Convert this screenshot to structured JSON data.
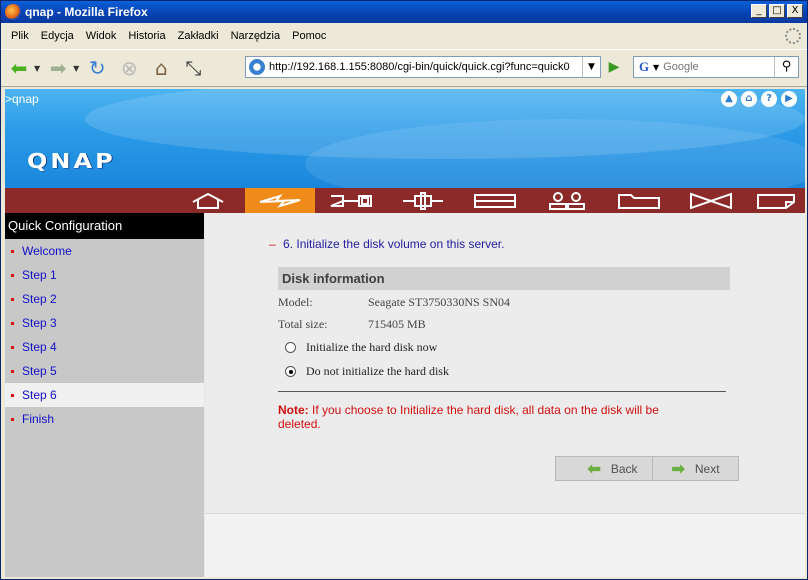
{
  "window": {
    "title": "qnap - Mozilla Firefox",
    "controls": [
      "_",
      "□",
      "X"
    ]
  },
  "menu": [
    "Plik",
    "Edycja",
    "Widok",
    "Historia",
    "Zakładki",
    "Narzędzia",
    "Pomoc"
  ],
  "toolbar": {
    "url": "http://192.168.1.155:8080/cgi-bin/quick/quick.cgi?func=quick0",
    "search_engine_icon": "G",
    "search_placeholder": "Google"
  },
  "banner": {
    "breadcrumb": ">qnap",
    "logo": "QNAP",
    "right_icons": [
      "up-icon",
      "home-icon",
      "help-icon",
      "next-icon"
    ]
  },
  "main_nav": [
    "home-icon",
    "quick-config-icon",
    "system-icon",
    "network-icon",
    "disk-icon",
    "users-icon",
    "shares-icon",
    "system-tools-icon",
    "logs-icon"
  ],
  "sidebar": {
    "heading": "Quick Configuration",
    "items": [
      "Welcome",
      "Step 1",
      "Step 2",
      "Step 3",
      "Step 4",
      "Step 5",
      "Step 6",
      "Finish"
    ],
    "active_index": 6
  },
  "step": {
    "dash": "–",
    "heading": "6. Initialize the disk volume on this server."
  },
  "disk": {
    "header": "Disk information",
    "model_label": "Model:",
    "model_value": "Seagate ST3750330NS SN04",
    "size_label": "Total size:",
    "size_value": "715405 MB"
  },
  "options": {
    "init_now": "Initialize the hard disk now",
    "no_init": "Do not initialize the hard disk",
    "selected": "no_init"
  },
  "note": {
    "label": "Note:",
    "text": " If you choose to Initialize the hard disk, all data on the disk will be deleted."
  },
  "buttons": {
    "back": "Back",
    "next": "Next"
  },
  "colors": {
    "nav_bar": "#8b2a28",
    "nav_active": "#f08a18",
    "link": "#1010c8",
    "warning": "#d01010"
  }
}
